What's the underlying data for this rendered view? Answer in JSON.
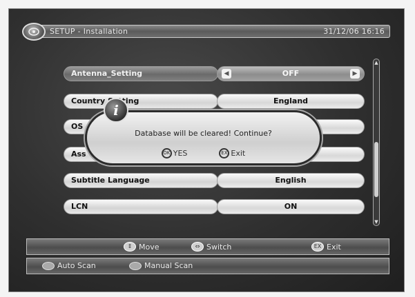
{
  "header": {
    "title": "SETUP - Installation",
    "clock": "31/12/06 16:16"
  },
  "menu": {
    "rows": [
      {
        "label": "Antenna_Setting",
        "value": "OFF",
        "selected": true
      },
      {
        "label": "Country Setting",
        "value": "England"
      },
      {
        "label": "OS",
        "value": ""
      },
      {
        "label": "Ass",
        "value": ""
      },
      {
        "label": "Subtitle Language",
        "value": "English"
      },
      {
        "label": "LCN",
        "value": "ON"
      }
    ]
  },
  "dialog": {
    "message": "Database will be cleared! Continue?",
    "yes_label": "YES",
    "exit_label": "Exit",
    "yes_key": "OK",
    "exit_key": "EX"
  },
  "footer": {
    "move_label": "Move",
    "switch_label": "Switch",
    "exit_label": "Exit",
    "auto_scan_label": "Auto Scan",
    "manual_scan_label": "Manual Scan"
  },
  "icons": {
    "info": "info-icon",
    "arrows": "left-right-arrow-icon"
  }
}
